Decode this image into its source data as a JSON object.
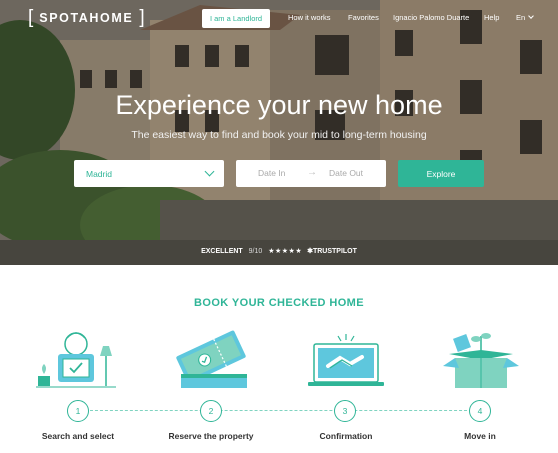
{
  "header": {
    "logo_text": "SPOTAHOME",
    "landlord_button": "I am a Landlord",
    "nav": {
      "how_it_works": "How it works",
      "favorites": "Favorites",
      "user_name": "Ignacio Palomo Duarte",
      "help": "Help",
      "language": "En"
    }
  },
  "hero": {
    "title": "Experience your new home",
    "subtitle": "The easiest way to find and book your mid to long-term housing"
  },
  "search": {
    "city": "Madrid",
    "date_in_placeholder": "Date In",
    "date_out_placeholder": "Date Out",
    "explore_label": "Explore"
  },
  "trust": {
    "rating_word": "EXCELLENT",
    "score": "9/10",
    "stars": "★★★★★",
    "provider": "TRUSTPILOT"
  },
  "steps_section": {
    "title": "BOOK YOUR CHECKED HOME",
    "steps": [
      {
        "number": "1",
        "label": "Search and select"
      },
      {
        "number": "2",
        "label": "Reserve the property"
      },
      {
        "number": "3",
        "label": "Confirmation"
      },
      {
        "number": "4",
        "label": "Move in"
      }
    ]
  },
  "colors": {
    "accent": "#2fb597",
    "accent_light": "#7fd3c0",
    "illustration_blue": "#5ec7dd",
    "text_dark": "#333333"
  },
  "icons": [
    "trustpilot-star-icon",
    "search-select-illustration",
    "reserve-ticket-illustration",
    "handshake-illustration",
    "move-in-box-illustration",
    "dropdown-chevron-icon",
    "arrow-right-icon"
  ]
}
